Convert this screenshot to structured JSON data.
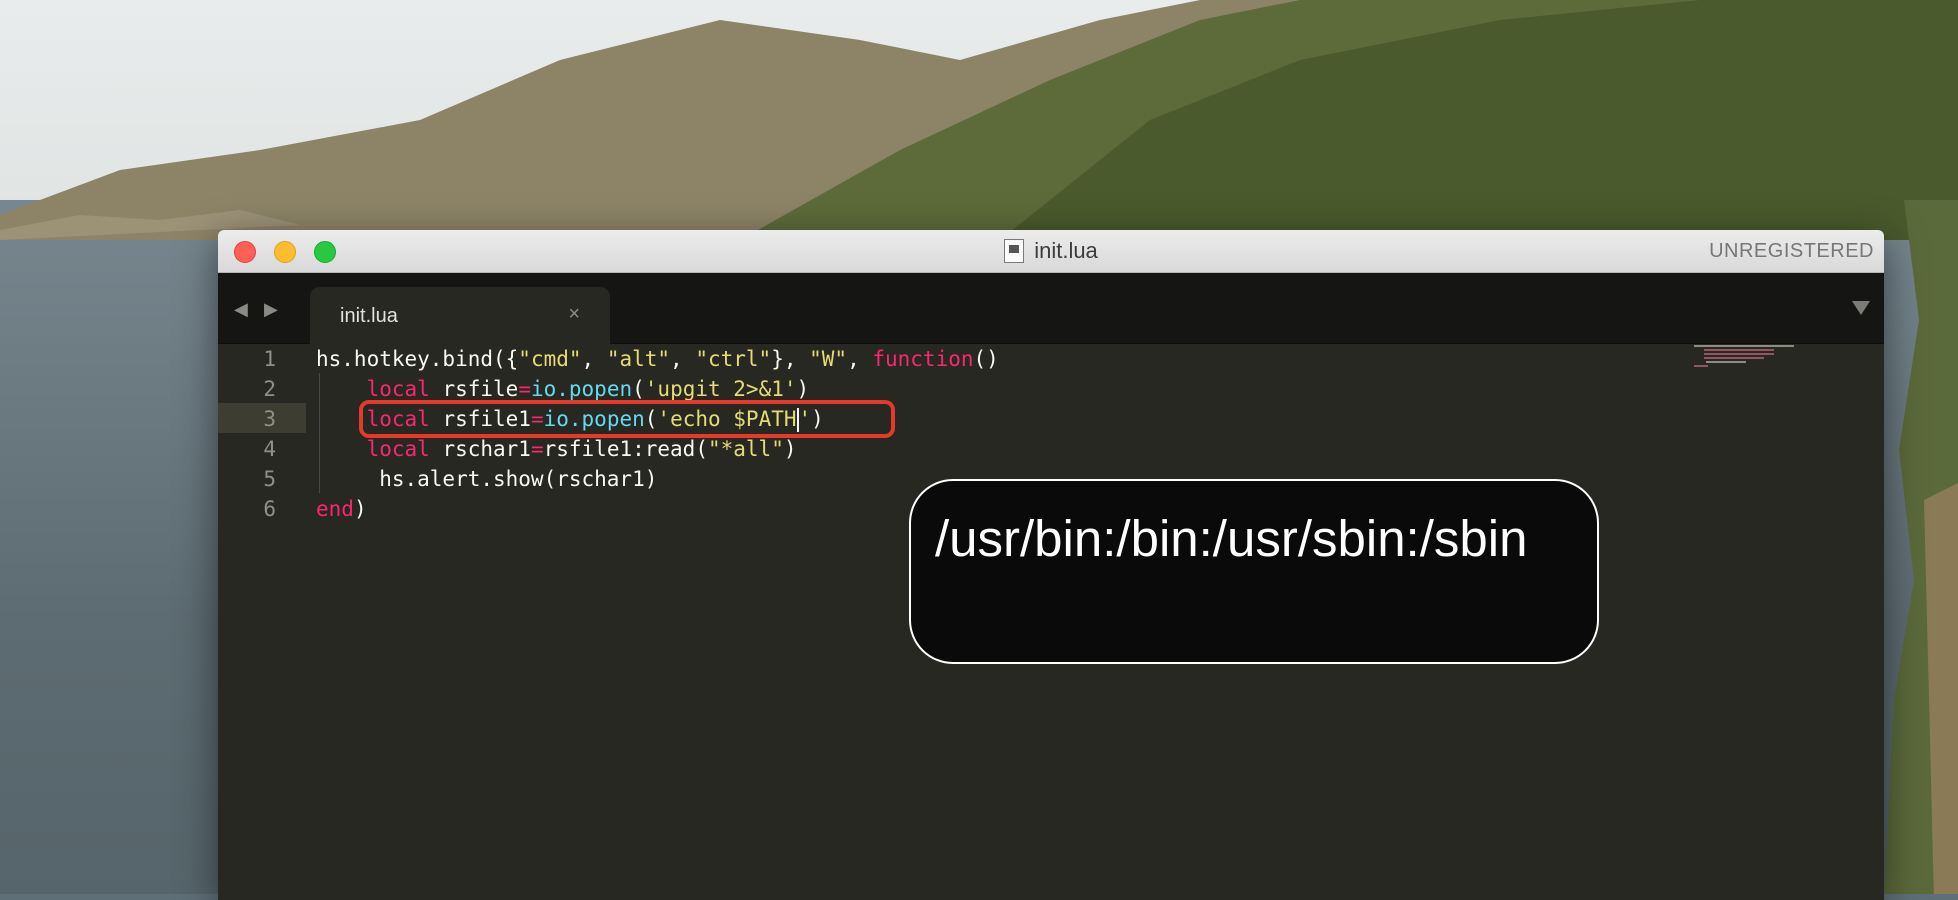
{
  "window": {
    "title": "init.lua",
    "registration_status": "UNREGISTERED"
  },
  "tabs": [
    {
      "label": "init.lua",
      "close_glyph": "×",
      "active": true
    }
  ],
  "editor": {
    "active_line": 3,
    "line_numbers": [
      "1",
      "2",
      "3",
      "4",
      "5",
      "6"
    ],
    "lines": [
      {
        "parts": [
          {
            "t": "hs.hotkey.bind({"
          },
          {
            "t": "\"cmd\"",
            "c": "str"
          },
          {
            "t": ", "
          },
          {
            "t": "\"alt\"",
            "c": "str"
          },
          {
            "t": ", "
          },
          {
            "t": "\"ctrl\"",
            "c": "str"
          },
          {
            "t": "}, "
          },
          {
            "t": "\"W\"",
            "c": "str"
          },
          {
            "t": ", "
          },
          {
            "t": "function",
            "c": "kw"
          },
          {
            "t": "()"
          }
        ]
      },
      {
        "parts": [
          {
            "t": "    "
          },
          {
            "t": "local",
            "c": "kw"
          },
          {
            "t": " rsfile"
          },
          {
            "t": "=",
            "c": "kw"
          },
          {
            "t": "io.popen",
            "c": "fn"
          },
          {
            "t": "("
          },
          {
            "t": "'upgit 2>&1'",
            "c": "str"
          },
          {
            "t": ")"
          }
        ]
      },
      {
        "parts": [
          {
            "t": "    "
          },
          {
            "t": "local",
            "c": "kw"
          },
          {
            "t": " rsfile1"
          },
          {
            "t": "=",
            "c": "kw"
          },
          {
            "t": "io.popen",
            "c": "fn"
          },
          {
            "t": "("
          },
          {
            "t": "'echo $PATH",
            "c": "str"
          },
          {
            "t": "|",
            "c": "cursor"
          },
          {
            "t": "'",
            "c": "str"
          },
          {
            "t": ")"
          }
        ]
      },
      {
        "parts": [
          {
            "t": "    "
          },
          {
            "t": "local",
            "c": "kw"
          },
          {
            "t": " rschar1"
          },
          {
            "t": "=",
            "c": "kw"
          },
          {
            "t": "rsfile1:read("
          },
          {
            "t": "\"*all\"",
            "c": "str"
          },
          {
            "t": ")"
          }
        ]
      },
      {
        "parts": [
          {
            "t": "     hs.alert.show(rschar1)"
          }
        ]
      },
      {
        "parts": [
          {
            "t": "end",
            "c": "kw"
          },
          {
            "t": ")"
          }
        ]
      }
    ]
  },
  "alert": {
    "text": "/usr/bin:/bin:/usr/sbin:/sbin"
  },
  "colors": {
    "editor_background": "#272822",
    "keyword": "#f92672",
    "string": "#e6db74",
    "function": "#66d9ef",
    "highlight_box": "#e5392a"
  },
  "icons": {
    "nav_back": "left-arrow-icon",
    "nav_forward": "right-arrow-icon",
    "tab_dropdown": "triangle-down-icon",
    "file": "document-icon"
  }
}
